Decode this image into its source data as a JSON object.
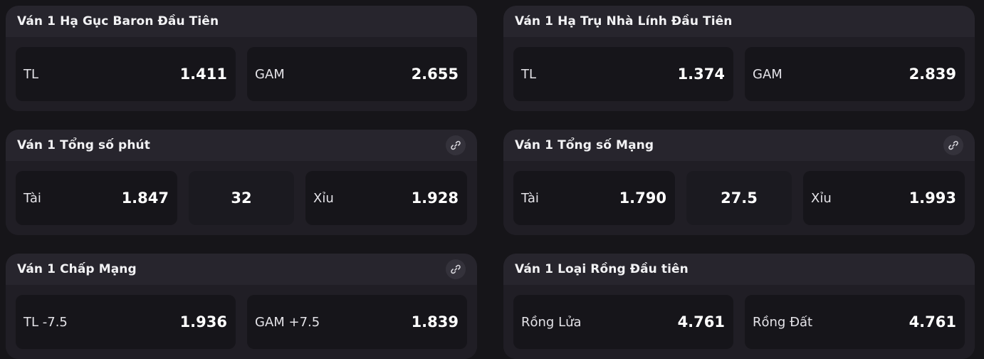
{
  "markets": [
    {
      "title": "Ván 1 Hạ Gục Baron Đầu Tiên",
      "has_link": false,
      "selections": [
        {
          "label": "TL",
          "odds": "1.411"
        },
        {
          "label": "GAM",
          "odds": "2.655"
        }
      ]
    },
    {
      "title": "Ván 1 Hạ Trụ Nhà Lính Đầu Tiên",
      "has_link": false,
      "selections": [
        {
          "label": "TL",
          "odds": "1.374"
        },
        {
          "label": "GAM",
          "odds": "2.839"
        }
      ]
    },
    {
      "title": "Ván 1 Tổng số phút",
      "has_link": true,
      "line": "32",
      "selections": [
        {
          "label": "Tài",
          "odds": "1.847"
        },
        {
          "label": "Xỉu",
          "odds": "1.928"
        }
      ]
    },
    {
      "title": "Ván 1 Tổng số Mạng",
      "has_link": true,
      "line": "27.5",
      "selections": [
        {
          "label": "Tài",
          "odds": "1.790"
        },
        {
          "label": "Xỉu",
          "odds": "1.993"
        }
      ]
    },
    {
      "title": "Ván 1 Chấp Mạng",
      "has_link": true,
      "selections": [
        {
          "label": "TL -7.5",
          "odds": "1.936"
        },
        {
          "label": "GAM +7.5",
          "odds": "1.839"
        }
      ]
    },
    {
      "title": "Ván 1 Loại Rồng Đầu tiên",
      "has_link": false,
      "selections": [
        {
          "label": "Rồng Lửa",
          "odds": "4.761"
        },
        {
          "label": "Rồng Đất",
          "odds": "4.761"
        }
      ]
    }
  ],
  "icons": {
    "link": "link-icon"
  },
  "colors": {
    "page_bg": "#161519",
    "card_header": "#27252d",
    "card_body": "#201e25",
    "odd_bg": "#16151a"
  }
}
